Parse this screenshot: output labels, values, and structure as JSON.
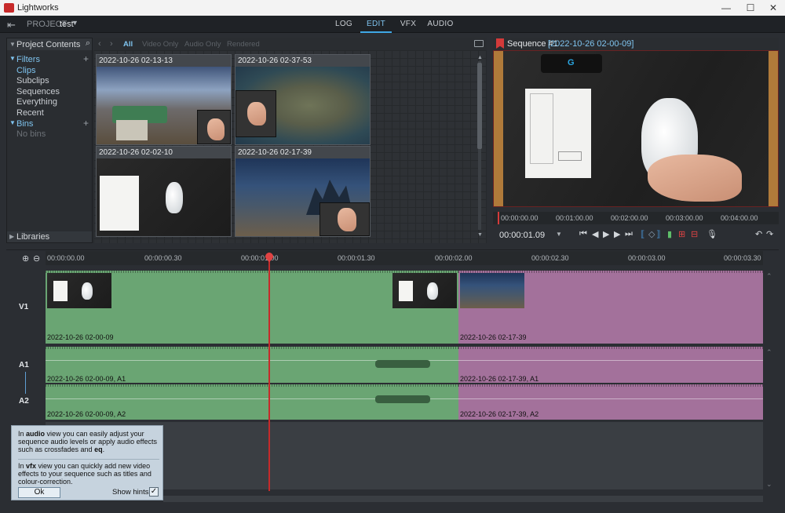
{
  "window": {
    "title": "Lightworks",
    "minimize": "—",
    "maximize": "☐",
    "close": "✕"
  },
  "header": {
    "project_label": "PROJECT",
    "project_name": "test",
    "tabs": [
      "LOG",
      "EDIT",
      "VFX",
      "AUDIO"
    ],
    "active_tab": "EDIT"
  },
  "project_contents": {
    "title": "Project Contents",
    "filters_label": "Filters",
    "filters": [
      "Clips",
      "Subclips",
      "Sequences",
      "Everything",
      "Recent"
    ],
    "selected_filter": "Clips",
    "bins_label": "Bins",
    "bins_empty": "No bins",
    "libraries_label": "Libraries"
  },
  "bin": {
    "filters": [
      "All",
      "Video Only",
      "Audio Only",
      "Rendered"
    ],
    "active_filter": "All",
    "clips": [
      {
        "name": "2022-10-26 02-13-13",
        "kind": "game"
      },
      {
        "name": "2022-10-26 02-37-53",
        "kind": "map"
      },
      {
        "name": "2022-10-26 02-02-10",
        "kind": "desk"
      },
      {
        "name": "2022-10-26 02-17-39",
        "kind": "storm"
      }
    ]
  },
  "viewer": {
    "sequence_name": "Sequence #1",
    "sequence_clip": "[2022-10-26 02-00-09]",
    "ruler_ticks": [
      "00:00:00.00",
      "00:01:00.00",
      "00:02:00.00",
      "00:03:00.00",
      "00:04:00.00"
    ],
    "timecode": "00:00:01.09",
    "logo_glyph": "G"
  },
  "timeline": {
    "ruler_ticks": [
      "00:00:00.00",
      "00:00:00.30",
      "00:00:01.00",
      "00:00:01.30",
      "00:00:02.00",
      "00:00:02.30",
      "00:00:03.00",
      "00:00:03.30"
    ],
    "tracks": [
      "V1",
      "A1",
      "A2"
    ],
    "clips": {
      "v1_a": "2022-10-26 02-00-09",
      "v1_b": "2022-10-26 02-17-39",
      "a1_a": "2022-10-26 02-00-09, A1",
      "a1_b": "2022-10-26 02-17-39, A1",
      "a2_a": "2022-10-26 02-00-09, A2",
      "a2_b": "2022-10-26 02-17-39, A2"
    }
  },
  "hint": {
    "p1_pre": "In ",
    "p1_bold": "audio",
    "p1_mid": " view you can easily adjust your sequence audio levels or apply audio effects such as crossfades and ",
    "p1_bold2": "eq",
    "p1_end": ".",
    "p2_pre": "In ",
    "p2_bold": "vfx",
    "p2_rest": " view you can quickly add new video effects to your sequence such as titles and colour-correction.",
    "ok_label": "Ok",
    "show_hints_label": "Show hints",
    "show_hints_checked": true
  },
  "colors": {
    "accent": "#3fa8e6",
    "video_clip": "#6aa573",
    "second_clip": "#a3719b",
    "playhead": "#c62a2a"
  }
}
